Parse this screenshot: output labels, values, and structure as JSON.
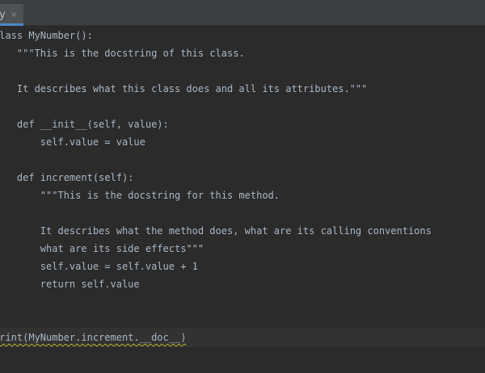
{
  "tab": {
    "label": "y",
    "close_icon": "×"
  },
  "code": {
    "lines": [
      "class MyNumber():",
      "    \"\"\"This is the docstring of this class.",
      "",
      "    It describes what this class does and all its attributes.\"\"\"",
      "",
      "    def __init__(self, value):",
      "        self.value = value",
      "",
      "    def increment(self):",
      "        \"\"\"This is the docstring for this method.",
      "",
      "        It describes what the method does, what are its calling conventions",
      "        what are its side effects\"\"\"",
      "        self.value = self.value + 1",
      "        return self.value",
      "",
      "",
      "print(MyNumber.increment.__doc__)"
    ]
  },
  "colors": {
    "background": "#2b2b2b",
    "text": "#a9b7c6",
    "tab_active": "#4e5254",
    "tab_accent": "#4a88c7",
    "warning_underline": "#bbb529"
  }
}
